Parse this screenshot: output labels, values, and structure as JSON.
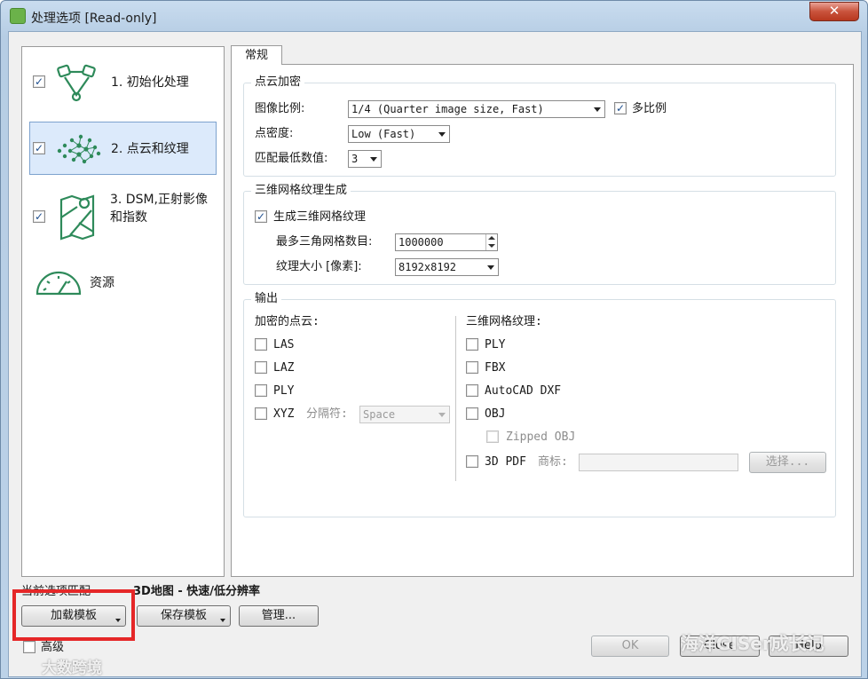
{
  "window": {
    "title": "处理选项 [Read-only]",
    "close_glyph": "✕"
  },
  "nav": {
    "items": [
      {
        "label": "1. 初始化处理",
        "checked": true,
        "icon": "initial-processing-icon"
      },
      {
        "label": "2. 点云和纹理",
        "checked": true,
        "icon": "point-cloud-icon",
        "selected": true
      },
      {
        "label_line1": "3. DSM,正射影像",
        "label_line2": "和指数",
        "checked": true,
        "icon": "dsm-map-icon"
      },
      {
        "label": "资源",
        "icon": "resources-gauge-icon"
      }
    ]
  },
  "tab": {
    "label": "常规"
  },
  "densification": {
    "title": "点云加密",
    "image_scale_label": "图像比例:",
    "image_scale_value": "1/4 (Quarter image size, Fast)",
    "multiscale_label": "多比例",
    "multiscale_checked": true,
    "point_density_label": "点密度:",
    "point_density_value": "Low (Fast)",
    "min_matches_label": "匹配最低数值:",
    "min_matches_value": "3"
  },
  "mesh": {
    "title": "三维网格纹理生成",
    "generate_label": "生成三维网格纹理",
    "generate_checked": true,
    "max_triangles_label": "最多三角网格数目:",
    "max_triangles_value": "1000000",
    "texture_size_label": "纹理大小 [像素]:",
    "texture_size_value": "8192x8192"
  },
  "output": {
    "title": "输出",
    "pointcloud_heading": "加密的点云:",
    "pointcloud_formats": [
      "LAS",
      "LAZ",
      "PLY",
      "XYZ"
    ],
    "delimiter_label": "分隔符:",
    "delimiter_value": "Space",
    "mesh_heading": "三维网格纹理:",
    "mesh_formats": [
      "PLY",
      "FBX",
      "AutoCAD DXF",
      "OBJ"
    ],
    "zipped_obj_label": "Zipped OBJ",
    "pdf3d_label": "3D PDF",
    "logo_label": "商标:",
    "choose_button": "选择..."
  },
  "footer": {
    "current_match_label": "当前选项匹配",
    "template_name": "3D地图 - 快速/低分辨率",
    "load_template": "加载模板",
    "save_template": "保存模板",
    "manage": "管理...",
    "advanced_label": "高级",
    "ok": "OK",
    "close": "Close",
    "help": "Help"
  },
  "watermarks": {
    "right": "海洋GISer成长记",
    "left": "大数跨境"
  },
  "colors": {
    "icon_green": "#2e8a5a",
    "highlight_red": "#e52728",
    "selection_blue": "#dceafb"
  }
}
